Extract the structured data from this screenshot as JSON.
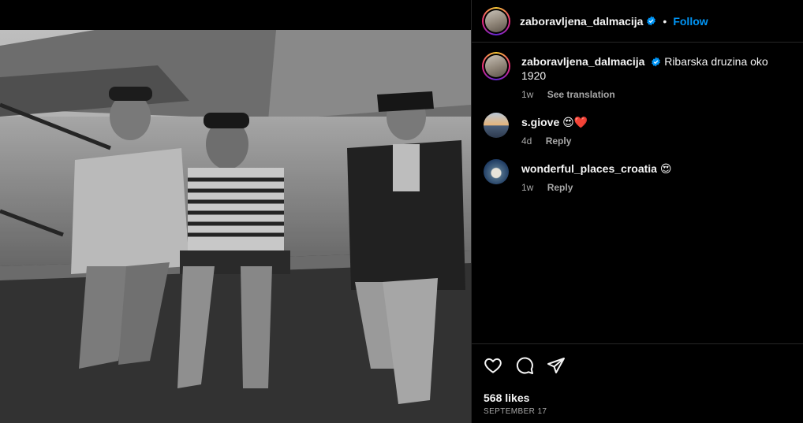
{
  "post": {
    "username": "zaboravljena_dalmacija",
    "follow_label": "Follow",
    "dot": "•",
    "caption_user": "zaboravljena_dalmacija",
    "caption": "Ribarska druzina oko 1920",
    "caption_time": "1w",
    "see_translation": "See translation",
    "likes": "568 likes",
    "date": "September 17"
  },
  "comments": [
    {
      "user": "s.giove",
      "text": "😍❤️",
      "time": "4d",
      "reply": "Reply",
      "avatar": "sunset-avatar"
    },
    {
      "user": "wonderful_places_croatia",
      "text": "😍",
      "time": "1w",
      "reply": "Reply",
      "avatar": "island-avatar"
    }
  ],
  "icons": {
    "like": "heart-icon",
    "comment": "comment-bubble-icon",
    "share": "paper-plane-icon",
    "verified": "verified-badge-icon"
  },
  "colors": {
    "background": "#000000",
    "text": "#f5f5f5",
    "secondary": "#a8a8a8",
    "accent": "#0095f6",
    "divider": "#262626"
  }
}
